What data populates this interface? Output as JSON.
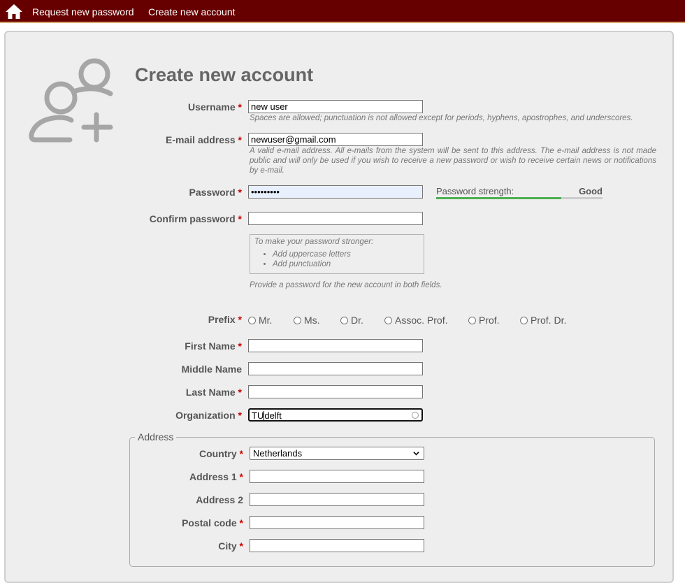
{
  "nav": {
    "request_password": "Request new password",
    "create_account": "Create new account"
  },
  "page": {
    "title": "Create new account"
  },
  "form": {
    "required_marker": "*",
    "username": {
      "label": "Username",
      "value": "new user",
      "description": "Spaces are allowed; punctuation is not allowed except for periods, hyphens, apostrophes, and underscores."
    },
    "email": {
      "label": "E-mail address",
      "value": "newuser@gmail.com",
      "description": "A valid e-mail address. All e-mails from the system will be sent to this address. The e-mail address is not made public and will only be used if you wish to receive a new password or wish to receive certain news or notifications by e-mail."
    },
    "password": {
      "label": "Password",
      "value": "•••••••••",
      "strength_label": "Password strength:",
      "strength_value": "Good",
      "strength_level": 0.75
    },
    "confirm_password": {
      "label": "Confirm password",
      "value": ""
    },
    "password_suggestions": {
      "hint": "To make your password stronger:",
      "items": [
        "Add uppercase letters",
        "Add punctuation"
      ]
    },
    "password_description": "Provide a password for the new account in both fields.",
    "prefix": {
      "label": "Prefix",
      "options": [
        "Mr.",
        "Ms.",
        "Dr.",
        "Assoc. Prof.",
        "Prof.",
        "Prof. Dr."
      ]
    },
    "first_name": {
      "label": "First Name",
      "value": ""
    },
    "middle_name": {
      "label": "Middle Name",
      "value": ""
    },
    "last_name": {
      "label": "Last Name",
      "value": ""
    },
    "organization": {
      "label": "Organization",
      "value_before_caret": "TU",
      "value_after_caret": "delft"
    },
    "address": {
      "legend": "Address",
      "country": {
        "label": "Country",
        "value": "Netherlands"
      },
      "address1": {
        "label": "Address 1",
        "value": ""
      },
      "address2": {
        "label": "Address 2",
        "value": ""
      },
      "postal_code": {
        "label": "Postal code",
        "value": ""
      },
      "city": {
        "label": "City",
        "value": ""
      }
    }
  },
  "colors": {
    "topbar": "#660000",
    "required": "#cc0000",
    "strength_good": "#4caf50"
  }
}
